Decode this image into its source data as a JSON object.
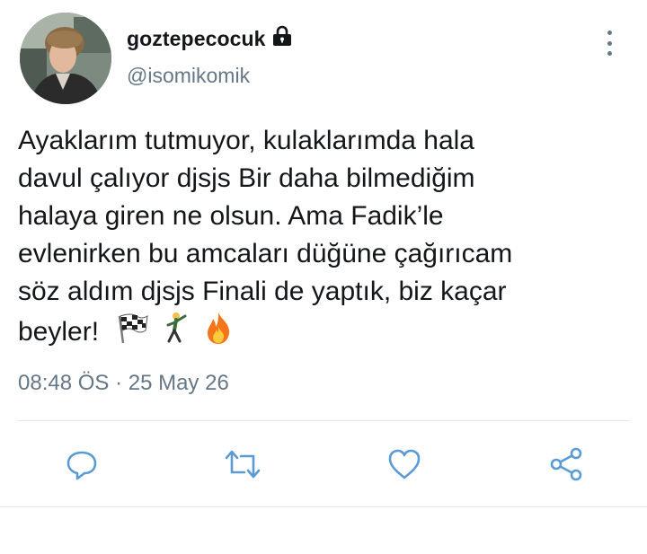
{
  "user": {
    "display_name": "goztepecocuk",
    "handle": "@isomikomik",
    "protected_icon": "lock-icon",
    "avatar_icon": "avatar-photo"
  },
  "tweet": {
    "lines": [
      "Ayaklarım tutmuyor, kulaklarımda hala",
      "davul çalıyor djsjs Bir daha bilmediğim",
      "halaya giren ne olsun. Ama Fadik’le",
      "evlenirken bu amcaları düğüne çağırıcam",
      "söz aldım djsjs Finali de yaptık, biz kaçar",
      "beyler!"
    ],
    "emojis": [
      "chequered-flag-emoji",
      "dancing-man-emoji",
      "fire-emoji"
    ],
    "timestamp": "08:48 ÖS · 25 May 26"
  },
  "actions": {
    "reply": "reply-icon",
    "retweet": "retweet-icon",
    "like": "heart-icon",
    "share": "share-icon",
    "more": "more-options-icon"
  },
  "colors": {
    "text": "#14171a",
    "secondary": "#657786",
    "icon_blue": "#5b9bd5",
    "divider": "#e1e8ed"
  }
}
